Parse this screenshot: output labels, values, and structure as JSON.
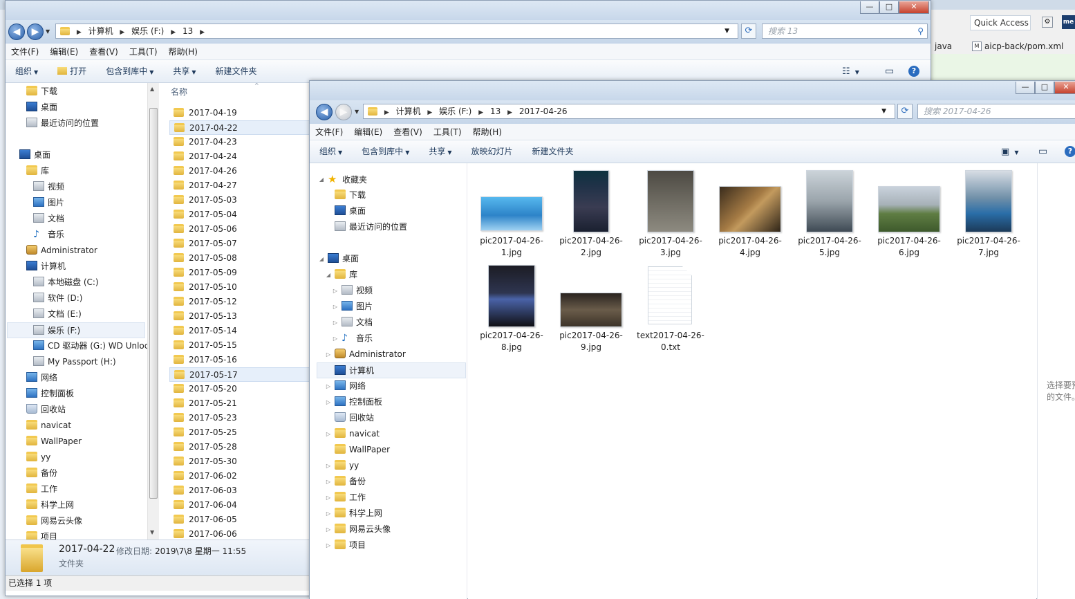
{
  "background": {
    "quick_access": "Quick Access",
    "tab_java": "java",
    "tab_pom": "aicp-back/pom.xml",
    "tab_pom_icon_text": "M",
    "me_badge": "me"
  },
  "win1": {
    "controls": {
      "min": "—",
      "max": "□",
      "close": "✕"
    },
    "breadcrumb": [
      "计算机",
      "娱乐 (F:)",
      "13"
    ],
    "search_placeholder": "搜索 13",
    "menu": [
      "文件(F)",
      "编辑(E)",
      "查看(V)",
      "工具(T)",
      "帮助(H)"
    ],
    "toolbar": {
      "organize": "组织",
      "open": "打开",
      "include_library": "包含到库中",
      "share": "共享",
      "new_folder": "新建文件夹"
    },
    "nav_items": [
      {
        "label": "下载",
        "icon": "folder-icon"
      },
      {
        "label": "桌面",
        "icon": "desktop-icon"
      },
      {
        "label": "最近访问的位置",
        "icon": "recent-places-icon"
      },
      {
        "label": "桌面",
        "icon": "desktop-icon"
      },
      {
        "label": "库",
        "icon": "library-icon"
      },
      {
        "label": "视频",
        "icon": "video-icon"
      },
      {
        "label": "图片",
        "icon": "pictures-icon"
      },
      {
        "label": "文档",
        "icon": "documents-icon"
      },
      {
        "label": "音乐",
        "icon": "music-icon"
      },
      {
        "label": "Administrator",
        "icon": "user-folder-icon"
      },
      {
        "label": "计算机",
        "icon": "computer-icon"
      },
      {
        "label": "本地磁盘 (C:)",
        "icon": "system-drive-icon"
      },
      {
        "label": "软件 (D:)",
        "icon": "drive-icon"
      },
      {
        "label": "文档 (E:)",
        "icon": "drive-icon"
      },
      {
        "label": "娱乐 (F:)",
        "icon": "drive-icon"
      },
      {
        "label": "CD 驱动器 (G:) WD Unloc",
        "icon": "cd-drive-icon"
      },
      {
        "label": "My Passport (H:)",
        "icon": "drive-icon"
      },
      {
        "label": "网络",
        "icon": "network-icon"
      },
      {
        "label": "控制面板",
        "icon": "control-panel-icon"
      },
      {
        "label": "回收站",
        "icon": "recycle-bin-icon"
      },
      {
        "label": "navicat",
        "icon": "folder-icon"
      },
      {
        "label": "WallPaper",
        "icon": "folder-icon"
      },
      {
        "label": "yy",
        "icon": "folder-icon"
      },
      {
        "label": "备份",
        "icon": "folder-icon"
      },
      {
        "label": "工作",
        "icon": "folder-icon"
      },
      {
        "label": "科学上网",
        "icon": "folder-icon"
      },
      {
        "label": "网易云头像",
        "icon": "folder-icon"
      },
      {
        "label": "项目",
        "icon": "folder-icon"
      }
    ],
    "column_name": "名称",
    "folders": [
      "2017-04-19",
      "2017-04-22",
      "2017-04-23",
      "2017-04-24",
      "2017-04-26",
      "2017-04-27",
      "2017-05-03",
      "2017-05-04",
      "2017-05-06",
      "2017-05-07",
      "2017-05-08",
      "2017-05-09",
      "2017-05-10",
      "2017-05-12",
      "2017-05-13",
      "2017-05-14",
      "2017-05-15",
      "2017-05-16",
      "2017-05-17",
      "2017-05-20",
      "2017-05-21",
      "2017-05-23",
      "2017-05-25",
      "2017-05-28",
      "2017-05-30",
      "2017-06-02",
      "2017-06-03",
      "2017-06-04",
      "2017-06-05",
      "2017-06-06"
    ],
    "selected_index": 1,
    "hover_index": 18,
    "details": {
      "name": "2017-04-22",
      "modified_label": "修改日期:",
      "modified_value": "2019\\7\\8 星期一 11:55",
      "type": "文件夹"
    },
    "status": "已选择 1 项"
  },
  "win2": {
    "controls": {
      "min": "—",
      "max": "□",
      "close": "✕"
    },
    "breadcrumb": [
      "计算机",
      "娱乐 (F:)",
      "13",
      "2017-04-26"
    ],
    "search_placeholder": "搜索 2017-04-26",
    "menu": [
      "文件(F)",
      "编辑(E)",
      "查看(V)",
      "工具(T)",
      "帮助(H)"
    ],
    "toolbar": {
      "organize": "组织",
      "include_library": "包含到库中",
      "share": "共享",
      "slideshow": "放映幻灯片",
      "new_folder": "新建文件夹"
    },
    "nav_items": [
      {
        "label": "收藏夹",
        "icon": "favorites-star-icon"
      },
      {
        "label": "下载",
        "icon": "folder-icon"
      },
      {
        "label": "桌面",
        "icon": "desktop-icon"
      },
      {
        "label": "最近访问的位置",
        "icon": "recent-places-icon"
      },
      {
        "label": "桌面",
        "icon": "desktop-icon"
      },
      {
        "label": "库",
        "icon": "library-icon"
      },
      {
        "label": "视频",
        "icon": "video-icon"
      },
      {
        "label": "图片",
        "icon": "pictures-icon"
      },
      {
        "label": "文档",
        "icon": "documents-icon"
      },
      {
        "label": "音乐",
        "icon": "music-icon"
      },
      {
        "label": "Administrator",
        "icon": "user-folder-icon"
      },
      {
        "label": "计算机",
        "icon": "computer-icon"
      },
      {
        "label": "网络",
        "icon": "network-icon"
      },
      {
        "label": "控制面板",
        "icon": "control-panel-icon"
      },
      {
        "label": "回收站",
        "icon": "recycle-bin-icon"
      },
      {
        "label": "navicat",
        "icon": "folder-icon"
      },
      {
        "label": "WallPaper",
        "icon": "folder-icon"
      },
      {
        "label": "yy",
        "icon": "folder-icon"
      },
      {
        "label": "备份",
        "icon": "folder-icon"
      },
      {
        "label": "工作",
        "icon": "folder-icon"
      },
      {
        "label": "科学上网",
        "icon": "folder-icon"
      },
      {
        "label": "网易云头像",
        "icon": "folder-icon"
      },
      {
        "label": "项目",
        "icon": "folder-icon"
      }
    ],
    "files": [
      {
        "line1": "pic2017-04-26-",
        "line2": "1.jpg",
        "icon": "image-thumbnail-icon"
      },
      {
        "line1": "pic2017-04-26-",
        "line2": "2.jpg",
        "icon": "image-thumbnail-icon"
      },
      {
        "line1": "pic2017-04-26-",
        "line2": "3.jpg",
        "icon": "image-thumbnail-icon"
      },
      {
        "line1": "pic2017-04-26-",
        "line2": "4.jpg",
        "icon": "image-thumbnail-icon"
      },
      {
        "line1": "pic2017-04-26-",
        "line2": "5.jpg",
        "icon": "image-thumbnail-icon"
      },
      {
        "line1": "pic2017-04-26-",
        "line2": "6.jpg",
        "icon": "image-thumbnail-icon"
      },
      {
        "line1": "pic2017-04-26-",
        "line2": "7.jpg",
        "icon": "image-thumbnail-icon"
      },
      {
        "line1": "pic2017-04-26-",
        "line2": "8.jpg",
        "icon": "image-thumbnail-icon"
      },
      {
        "line1": "pic2017-04-26-",
        "line2": "9.jpg",
        "icon": "image-thumbnail-icon"
      },
      {
        "line1": "text2017-04-26-",
        "line2": "0.txt",
        "icon": "text-file-icon"
      }
    ],
    "preview_text_1": "选择要预",
    "preview_text_2": "的文件。"
  }
}
